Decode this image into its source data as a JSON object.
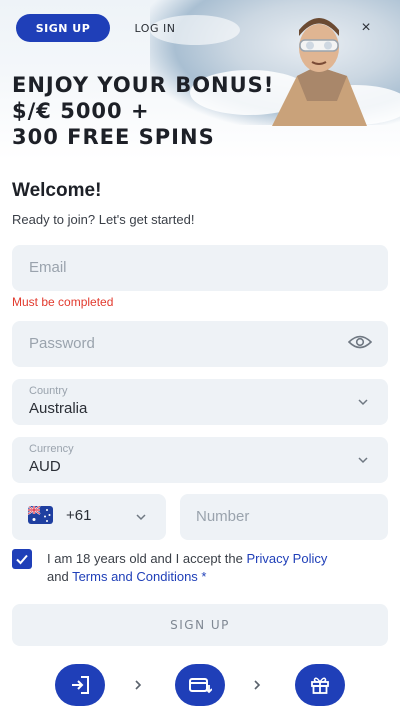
{
  "tabs": {
    "signup": "SIGN UP",
    "login": "LOG IN"
  },
  "header": {
    "close_symbol": "×"
  },
  "promo": {
    "line1": "ENJOY YOUR BONUS!",
    "line2": "$/€ 5000 +",
    "line3": "300 FREE SPINS"
  },
  "form": {
    "welcome": "Welcome!",
    "subtitle": "Ready to join? Let's get started!",
    "email": {
      "placeholder": "Email",
      "value": "",
      "error": "Must be completed"
    },
    "password": {
      "placeholder": "Password",
      "value": ""
    },
    "country": {
      "label": "Country",
      "value": "Australia"
    },
    "currency": {
      "label": "Currency",
      "value": "AUD"
    },
    "phone": {
      "dial_code": "+61",
      "placeholder": "Number",
      "flag": "australia-flag"
    },
    "consent": {
      "checked": true,
      "text_before": "I am 18 years old and I accept the ",
      "privacy_link": "Privacy Policy",
      "and": "and ",
      "terms_link": "Terms and Conditions",
      "required_mark": " *"
    },
    "submit_label": "SIGN UP"
  },
  "steps": [
    {
      "icon": "login-icon"
    },
    {
      "icon": "wallet-card-icon"
    },
    {
      "icon": "gift-icon"
    }
  ],
  "colors": {
    "accent": "#1f3fb8",
    "field_bg": "#eef2f6",
    "error": "#e23a2e",
    "placeholder": "#9aa3ad"
  }
}
